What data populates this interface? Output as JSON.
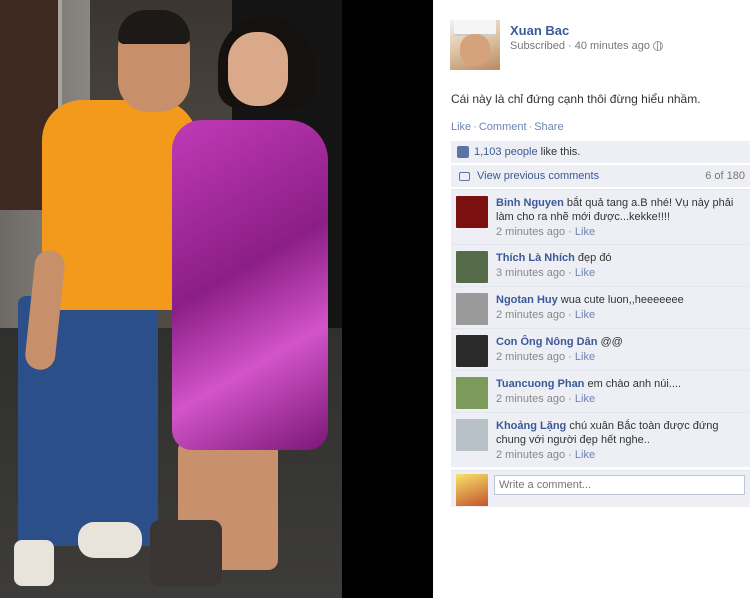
{
  "photo": {
    "alt": ""
  },
  "post": {
    "author": "Xuan Bac",
    "subscribed": "Subscribed",
    "time": "40 minutes ago",
    "text": "Cái này là chỉ đứng cạnh thôi đừng hiểu nhầm.",
    "actions": [
      "Like",
      "Comment",
      "Share"
    ]
  },
  "likes": {
    "count": "1,103 people",
    "rest": "like this."
  },
  "previous": {
    "label": "View previous comments",
    "pager": "6 of 180"
  },
  "comments": [
    {
      "name": "Binh Nguyen",
      "text": "bắt quả tang a.B nhé! Vụ này phải làm cho ra nhẽ mới được...kekke!!!!",
      "time": "2 minutes ago",
      "like": "Like",
      "avatar_color": "#7a1010"
    },
    {
      "name": "Thích Là Nhích",
      "text": "đẹp đó",
      "time": "3 minutes ago",
      "like": "Like",
      "avatar_color": "#556b4a"
    },
    {
      "name": "Ngotan Huy",
      "text": "wua cute luon,,heeeeeee",
      "time": "2 minutes ago",
      "like": "Like",
      "avatar_color": "#9a9a9a"
    },
    {
      "name": "Con Ông Nông Dân",
      "text": "@@",
      "time": "2 minutes ago",
      "like": "Like",
      "avatar_color": "#2a2a2a"
    },
    {
      "name": "Tuancuong Phan",
      "text": "em chào anh núi....",
      "time": "2 minutes ago",
      "like": "Like",
      "avatar_color": "#7b9a5c"
    },
    {
      "name": "Khoảng Lặng",
      "text": "chú xuân Bắc toàn được đứng chung với người đẹp hết nghe..",
      "time": "2 minutes ago",
      "like": "Like",
      "avatar_color": "#b8c0c8"
    }
  ],
  "write": {
    "placeholder": "Write a comment..."
  }
}
